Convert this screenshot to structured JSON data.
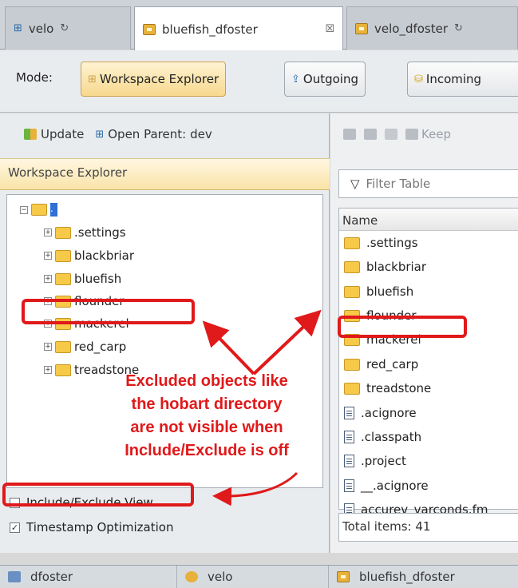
{
  "tabs": [
    {
      "label": "velo",
      "suffix": "↻"
    },
    {
      "label": "bluefish_dfoster",
      "suffix": "☒"
    },
    {
      "label": "velo_dfoster",
      "suffix": "↻"
    }
  ],
  "mode_bar": {
    "label": "Mode:",
    "buttons": [
      "Workspace Explorer",
      "Outgoing",
      "Incoming"
    ]
  },
  "left_toolbar": {
    "update": "Update",
    "open_parent": "Open Parent:",
    "parent_name": "dev"
  },
  "left_header": "Workspace Explorer",
  "tree": {
    "root": ".",
    "items": [
      ".settings",
      "blackbriar",
      "bluefish",
      "flounder",
      "mackerel",
      "red_carp",
      "treadstone"
    ]
  },
  "options": {
    "include_exclude": {
      "label": "Include/Exclude View",
      "checked": false
    },
    "timestamp": {
      "label": "Timestamp Optimization",
      "checked": true
    }
  },
  "right_toolbar": {
    "keep": "Keep"
  },
  "filter_placeholder": "Filter Table",
  "table": {
    "header": "Name",
    "rows": [
      {
        "name": ".settings",
        "kind": "folder"
      },
      {
        "name": "blackbriar",
        "kind": "folder"
      },
      {
        "name": "bluefish",
        "kind": "folder"
      },
      {
        "name": "flounder",
        "kind": "folder"
      },
      {
        "name": "mackerel",
        "kind": "folder"
      },
      {
        "name": "red_carp",
        "kind": "folder"
      },
      {
        "name": "treadstone",
        "kind": "folder"
      },
      {
        "name": ".acignore",
        "kind": "file"
      },
      {
        "name": ".classpath",
        "kind": "file"
      },
      {
        "name": ".project",
        "kind": "file"
      },
      {
        "name": "__.acignore",
        "kind": "file"
      },
      {
        "name": "accurev_varconds.fm",
        "kind": "file"
      }
    ],
    "total": "Total items: 41"
  },
  "status_bar": [
    "dfoster",
    "velo",
    "bluefish_dfoster"
  ],
  "annotation": {
    "lines": [
      "Excluded objects like",
      "the hobart directory",
      "are not visible when",
      "Include/Exclude is off"
    ]
  },
  "colors": {
    "annotation_red": "#e0191a",
    "active_mode": "#f7d98e",
    "folder": "#f7c948"
  }
}
